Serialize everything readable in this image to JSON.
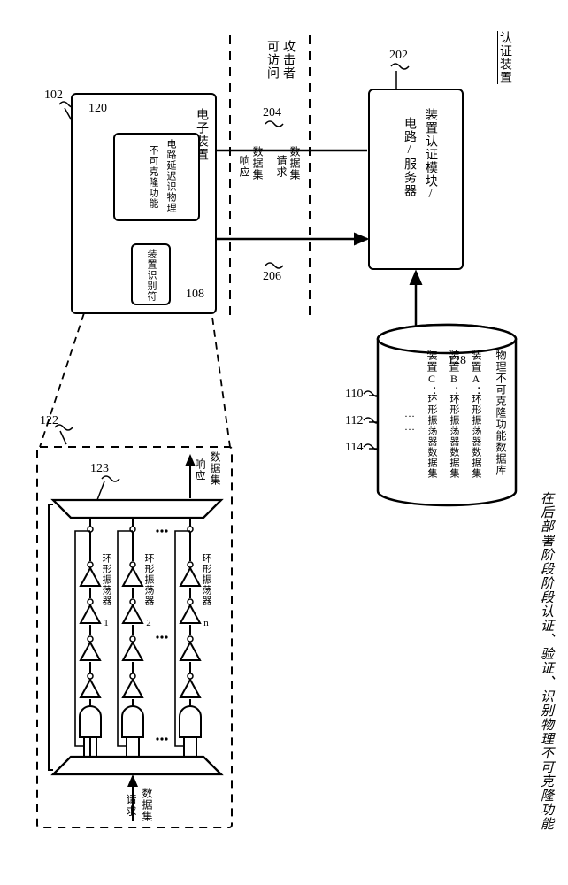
{
  "titles": {
    "auth_device": "认证装置",
    "attacker_access_1": "攻击者",
    "attacker_access_2": "可访问",
    "electronic_device": "电子装置"
  },
  "refs": {
    "r202": "202",
    "r204": "204",
    "r206": "206",
    "r128": "128",
    "r110": "110",
    "r112": "112",
    "r114": "114",
    "r120": "120",
    "r102": "102",
    "r108": "108",
    "r122": "122",
    "r123": "123"
  },
  "labels": {
    "dataset": "数据集",
    "request": "请求",
    "response": "响应",
    "auth_module_l1": "装置认证模块/",
    "auth_module_l2": "电路/服务器",
    "db_title": "物理不可克隆功能数据库",
    "db_row_a_l": "装置A：",
    "db_row_a_r": "环形振荡器数据集",
    "db_row_b_l": "装置B：",
    "db_row_b_r": "环形振荡器数据集",
    "db_row_c_l": "装置C：",
    "db_row_c_r": "环形振荡器数据集",
    "db_ellipsis": "……",
    "puf_l1": "电路延迟识物理",
    "puf_l2": "不可克隆功能",
    "dev_id": "装置识别符",
    "ro1": "环形振荡器-1",
    "ro2": "环形振荡器-2",
    "ron": "环形振荡器-n",
    "ds_req_1": "数据集",
    "ds_req_2": "请求",
    "ds_resp_1": "数据集",
    "ds_resp_2": "响应",
    "caption": "在后部署阶段阶段认证、验证、识别物理不可克隆功能"
  }
}
